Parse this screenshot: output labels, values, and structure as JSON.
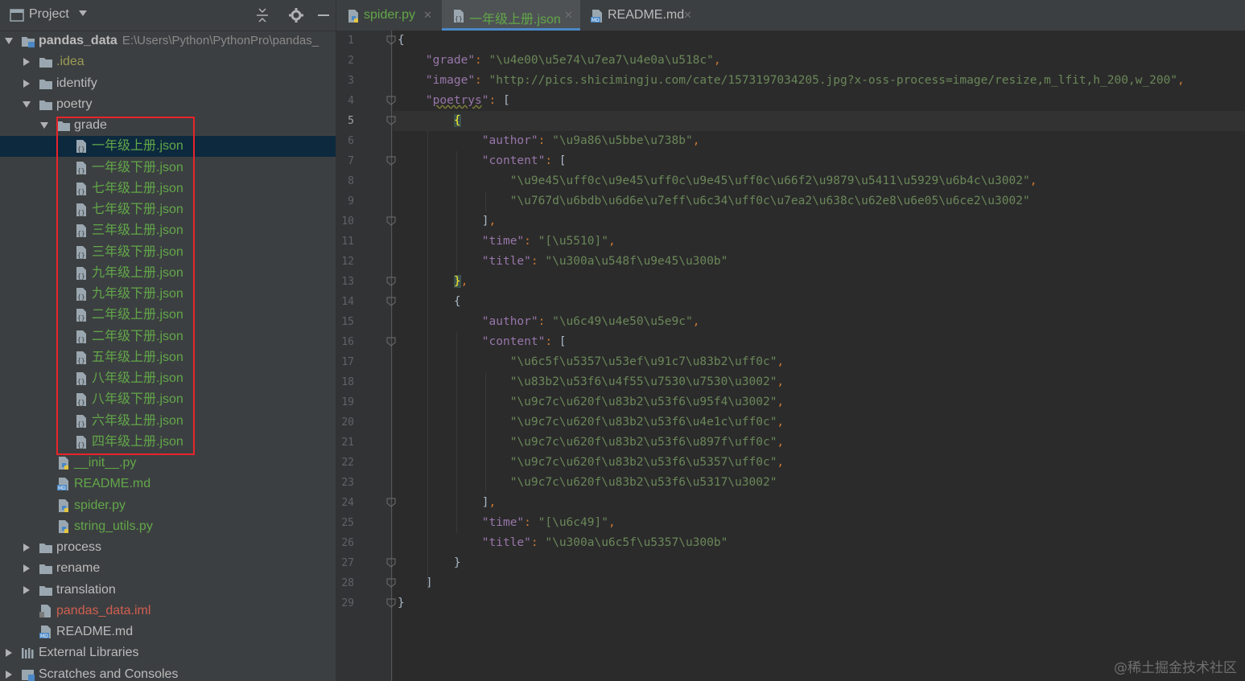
{
  "project_panel": {
    "title": "Project",
    "tree": [
      {
        "label": "pandas_data",
        "path": "E:\\Users\\Python\\PythonPro\\pandas_",
        "depth": 0,
        "expanded": true,
        "kind": "project-root",
        "color": "bold"
      },
      {
        "label": ".idea",
        "depth": 1,
        "expanded": false,
        "kind": "folder",
        "color": "idea"
      },
      {
        "label": "identify",
        "depth": 1,
        "expanded": false,
        "kind": "folder",
        "color": "default"
      },
      {
        "label": "poetry",
        "depth": 1,
        "expanded": true,
        "kind": "folder",
        "color": "default"
      },
      {
        "label": "grade",
        "depth": 2,
        "expanded": true,
        "kind": "folder",
        "color": "default"
      },
      {
        "label": "一年级上册.json",
        "depth": 3,
        "kind": "json",
        "color": "green",
        "selected": true
      },
      {
        "label": "一年级下册.json",
        "depth": 3,
        "kind": "json",
        "color": "green"
      },
      {
        "label": "七年级上册.json",
        "depth": 3,
        "kind": "json",
        "color": "green"
      },
      {
        "label": "七年级下册.json",
        "depth": 3,
        "kind": "json",
        "color": "green"
      },
      {
        "label": "三年级上册.json",
        "depth": 3,
        "kind": "json",
        "color": "green"
      },
      {
        "label": "三年级下册.json",
        "depth": 3,
        "kind": "json",
        "color": "green"
      },
      {
        "label": "九年级上册.json",
        "depth": 3,
        "kind": "json",
        "color": "green"
      },
      {
        "label": "九年级下册.json",
        "depth": 3,
        "kind": "json",
        "color": "green"
      },
      {
        "label": "二年级上册.json",
        "depth": 3,
        "kind": "json",
        "color": "green"
      },
      {
        "label": "二年级下册.json",
        "depth": 3,
        "kind": "json",
        "color": "green"
      },
      {
        "label": "五年级上册.json",
        "depth": 3,
        "kind": "json",
        "color": "green"
      },
      {
        "label": "八年级上册.json",
        "depth": 3,
        "kind": "json",
        "color": "green"
      },
      {
        "label": "八年级下册.json",
        "depth": 3,
        "kind": "json",
        "color": "green"
      },
      {
        "label": "六年级上册.json",
        "depth": 3,
        "kind": "json",
        "color": "green"
      },
      {
        "label": "四年级上册.json",
        "depth": 3,
        "kind": "json",
        "color": "green"
      },
      {
        "label": "__init__.py",
        "depth": 2,
        "kind": "python",
        "color": "green"
      },
      {
        "label": "README.md",
        "depth": 2,
        "kind": "markdown",
        "color": "green"
      },
      {
        "label": "spider.py",
        "depth": 2,
        "kind": "python",
        "color": "green"
      },
      {
        "label": "string_utils.py",
        "depth": 2,
        "kind": "python",
        "color": "green"
      },
      {
        "label": "process",
        "depth": 1,
        "expanded": false,
        "kind": "folder",
        "color": "default"
      },
      {
        "label": "rename",
        "depth": 1,
        "expanded": false,
        "kind": "folder",
        "color": "default"
      },
      {
        "label": "translation",
        "depth": 1,
        "expanded": false,
        "kind": "folder",
        "color": "default"
      },
      {
        "label": "pandas_data.iml",
        "depth": 1,
        "kind": "iml",
        "color": "red"
      },
      {
        "label": "README.md",
        "depth": 1,
        "kind": "markdown",
        "color": "default"
      },
      {
        "label": "External Libraries",
        "depth": 0,
        "expanded": false,
        "kind": "libraries",
        "color": "default"
      },
      {
        "label": "Scratches and Consoles",
        "depth": 0,
        "expanded": false,
        "kind": "scratches",
        "color": "default"
      }
    ]
  },
  "tabs": [
    {
      "label": "spider.py",
      "kind": "python",
      "active": false
    },
    {
      "label": "一年级上册.json",
      "kind": "json",
      "active": true
    },
    {
      "label": "README.md",
      "kind": "markdown",
      "active": false
    }
  ],
  "editor": {
    "current_line": 5,
    "lines": [
      "{",
      "    \"grade\": \"\\u4e00\\u5e74\\u7ea7\\u4e0a\\u518c\",",
      "    \"image\": \"http://pics.shicimingju.com/cate/1573197034205.jpg?x-oss-process=image/resize,m_lfit,h_200,w_200\",",
      "    \"poetrys\": [",
      "        {",
      "            \"author\": \"\\u9a86\\u5bbe\\u738b\",",
      "            \"content\": [",
      "                \"\\u9e45\\uff0c\\u9e45\\uff0c\\u9e45\\uff0c\\u66f2\\u9879\\u5411\\u5929\\u6b4c\\u3002\",",
      "                \"\\u767d\\u6bdb\\u6d6e\\u7eff\\u6c34\\uff0c\\u7ea2\\u638c\\u62e8\\u6e05\\u6ce2\\u3002\"",
      "            ],",
      "            \"time\": \"[\\u5510]\",",
      "            \"title\": \"\\u300a\\u548f\\u9e45\\u300b\"",
      "        },",
      "        {",
      "            \"author\": \"\\u6c49\\u4e50\\u5e9c\",",
      "            \"content\": [",
      "                \"\\u6c5f\\u5357\\u53ef\\u91c7\\u83b2\\uff0c\",",
      "                \"\\u83b2\\u53f6\\u4f55\\u7530\\u7530\\u3002\",",
      "                \"\\u9c7c\\u620f\\u83b2\\u53f6\\u95f4\\u3002\",",
      "                \"\\u9c7c\\u620f\\u83b2\\u53f6\\u4e1c\\uff0c\",",
      "                \"\\u9c7c\\u620f\\u83b2\\u53f6\\u897f\\uff0c\",",
      "                \"\\u9c7c\\u620f\\u83b2\\u53f6\\u5357\\uff0c\",",
      "                \"\\u9c7c\\u620f\\u83b2\\u53f6\\u5317\\u3002\"",
      "            ],",
      "            \"time\": \"[\\u6c49]\",",
      "            \"title\": \"\\u300a\\u6c5f\\u5357\\u300b\"",
      "        }",
      "    ]",
      "}"
    ]
  },
  "watermark": "@稀土掘金技术社区",
  "colors": {
    "bg": "#2b2b2b",
    "panel": "#3c3f41",
    "selection": "#0d293e",
    "key": "#9876aa",
    "string": "#6a8759",
    "punct": "#cc7832",
    "highlight_box": "#e8242c",
    "tab_underline": "#4a88c7"
  }
}
